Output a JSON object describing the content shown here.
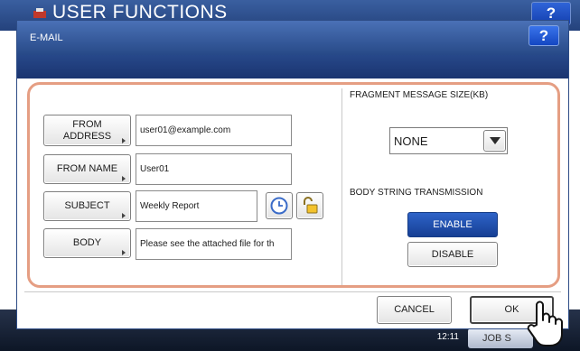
{
  "background": {
    "title": "USER FUNCTIONS",
    "help_label": "?",
    "time": "12:11",
    "job_button": "JOB S"
  },
  "dialog": {
    "title": "E-MAIL",
    "help_label": "?",
    "from_address": {
      "label": "FROM ADDRESS",
      "value": "user01@example.com"
    },
    "from_name": {
      "label": "FROM NAME",
      "value": "User01"
    },
    "subject": {
      "label": "SUBJECT",
      "value": "Weekly Report"
    },
    "body": {
      "label": "BODY",
      "value": "Please see the attached file for th"
    },
    "fragment_size": {
      "label": "FRAGMENT MESSAGE SIZE(KB)",
      "value": "NONE"
    },
    "body_string": {
      "label": "BODY STRING TRANSMISSION",
      "enable": "ENABLE",
      "disable": "DISABLE",
      "selected": "ENABLE"
    },
    "cancel_label": "CANCEL",
    "ok_label": "OK"
  },
  "colors": {
    "panel_border": "#e59e83",
    "selected_button": "#1f4fae",
    "title_bar": "#274987"
  }
}
